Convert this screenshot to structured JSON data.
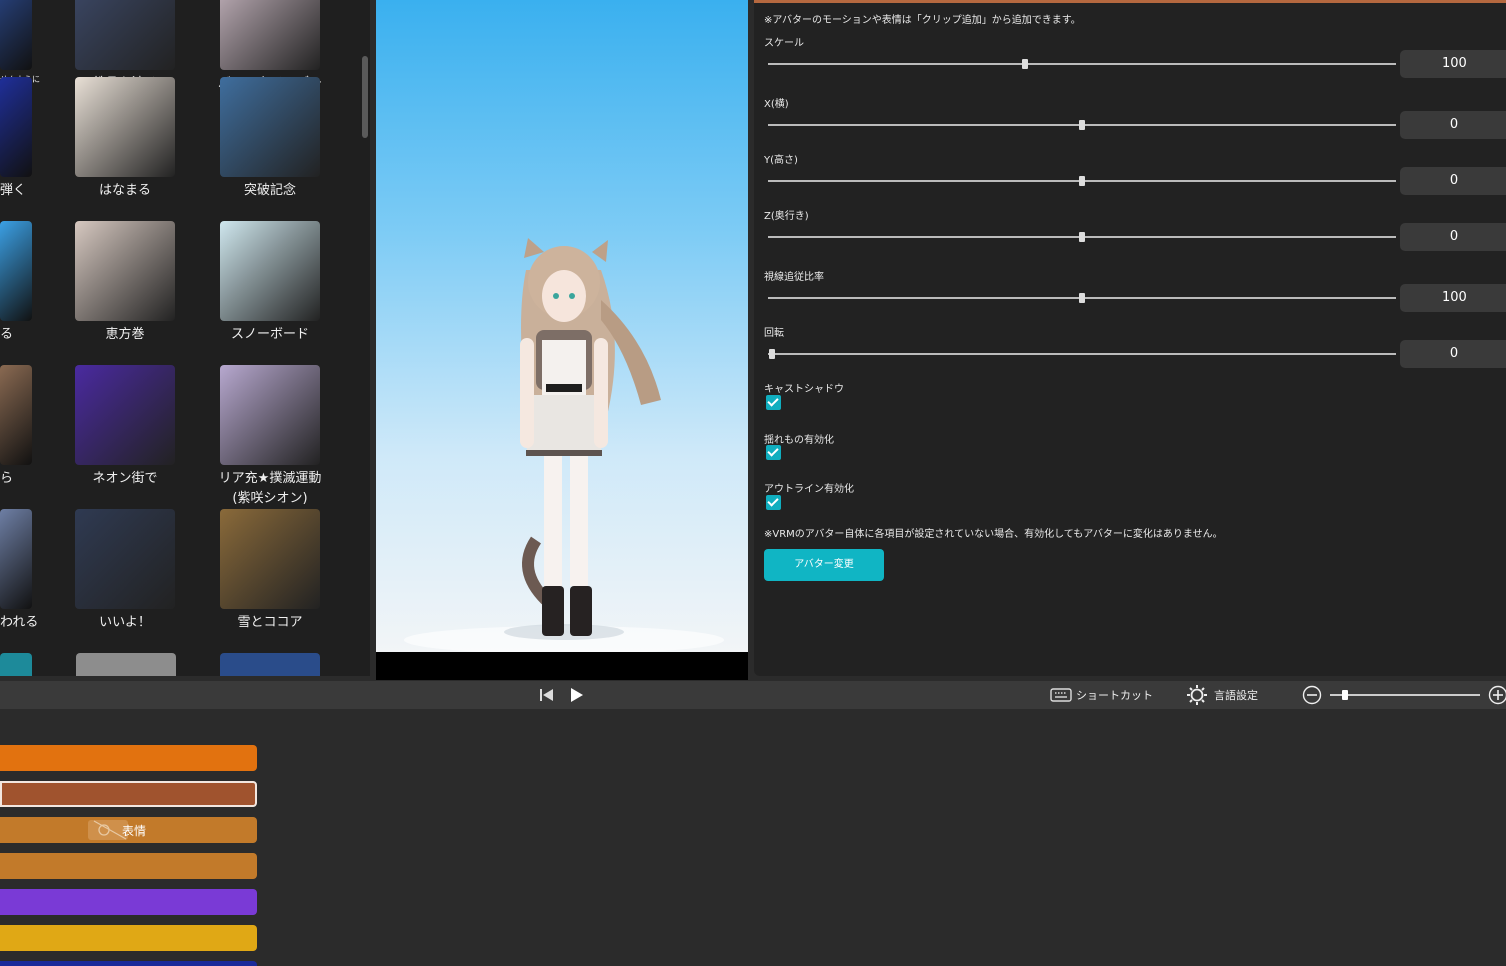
{
  "gallery": {
    "left_items": [
      {
        "caption": "せんように\nマ]",
        "color": "#2b4a90"
      },
      {
        "caption": "弾く",
        "color": "#1f2f9a"
      },
      {
        "caption": "る",
        "color": "#3ba0e5"
      },
      {
        "caption": "ら",
        "color": "#8a6a52"
      },
      {
        "caption": "われる",
        "color": "#6e7fa5"
      }
    ],
    "items": [
      {
        "caption": "鉄骨を渡る",
        "color": "#3d4a6a"
      },
      {
        "caption": "バレンタインデー",
        "color": "#c9b8c2"
      },
      {
        "caption": "はなまる",
        "color": "#e9e0d6"
      },
      {
        "caption": "突破記念",
        "color": "#3f6e9e"
      },
      {
        "caption": "恵方巻",
        "color": "#d6c8c0"
      },
      {
        "caption": "スノーボード",
        "color": "#cfe7ee"
      },
      {
        "caption": "ネオン街で",
        "color": "#4a2aa0"
      },
      {
        "caption": "リア充★撲滅運動\n(紫咲シオン)",
        "color": "#b7a8cf"
      },
      {
        "caption": "いいよ！",
        "color": "#2f3a52"
      },
      {
        "caption": "雪とココア",
        "color": "#8a6a3a"
      }
    ]
  },
  "settings": {
    "note_top": "※アバターのモーションや表情は「クリップ追加」から追加できます。",
    "sliders": [
      {
        "label": "スケール",
        "value": "100",
        "pos": 0.41
      },
      {
        "label": "X(横)",
        "value": "0",
        "pos": 0.5
      },
      {
        "label": "Y(高さ)",
        "value": "0",
        "pos": 0.5
      },
      {
        "label": "Z(奥行き)",
        "value": "0",
        "pos": 0.5
      },
      {
        "label": "視線追従比率",
        "value": "100",
        "pos": 0.5
      },
      {
        "label": "回転",
        "value": "0",
        "pos": 0.0
      }
    ],
    "checkboxes": [
      {
        "label": "キャストシャドウ",
        "checked": true
      },
      {
        "label": "揺れもの有効化",
        "checked": true
      },
      {
        "label": "アウトライン有効化",
        "checked": true
      }
    ],
    "note_bottom": "※VRMのアバター自体に各項目が設定されていない場合、有効化してもアバターに変化はありません。",
    "change_button": "アバター変更"
  },
  "toolbar": {
    "shortcut_label": "ショートカット",
    "language_label": "言語設定",
    "zoom_level": 0.08
  },
  "timeline": {
    "tracks": [
      {
        "label": "",
        "color": "#e2720f"
      },
      {
        "label": "",
        "color": "#a0532e"
      },
      {
        "label": "表情",
        "color": "#c27a2a"
      },
      {
        "label": "",
        "color": "#c27a2a"
      },
      {
        "label": "",
        "color": "#7a3ad6"
      },
      {
        "label": "",
        "color": "#e0a815"
      },
      {
        "label": "",
        "color": "#1a2a9a"
      }
    ]
  }
}
